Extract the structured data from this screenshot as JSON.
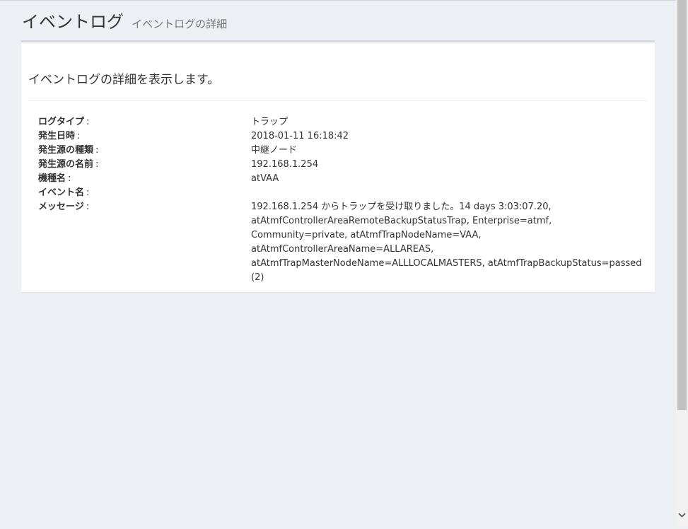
{
  "header": {
    "title": "イベントログ",
    "subtitle": "イベントログの詳細"
  },
  "box": {
    "heading": "イベントログの詳細を表示します。"
  },
  "details": [
    {
      "label": "ログタイプ",
      "value": "トラップ"
    },
    {
      "label": "発生日時",
      "value": "2018-01-11 16:18:42"
    },
    {
      "label": "発生源の種類",
      "value": "中継ノード"
    },
    {
      "label": "発生源の名前",
      "value": "192.168.1.254"
    },
    {
      "label": "機種名",
      "value": "atVAA"
    },
    {
      "label": "イベント名",
      "value": ""
    },
    {
      "label": "メッセージ",
      "value": "192.168.1.254 からトラップを受け取りました。14 days 3:03:07.20, atAtmfControllerAreaRemoteBackupStatusTrap, Enterprise=atmf, Community=private, atAtmfTrapNodeName=VAA, atAtmfControllerAreaName=ALLAREAS, atAtmfTrapMasterNodeName=ALLLOCALMASTERS, atAtmfTrapBackupStatus=passed (2)"
    }
  ],
  "colon": ":",
  "colors": {
    "background": "#ecf0f5",
    "box_border": "#d2d6de",
    "text": "#333333"
  },
  "scrollbar": {
    "down_icon": "chevron-down-icon"
  }
}
